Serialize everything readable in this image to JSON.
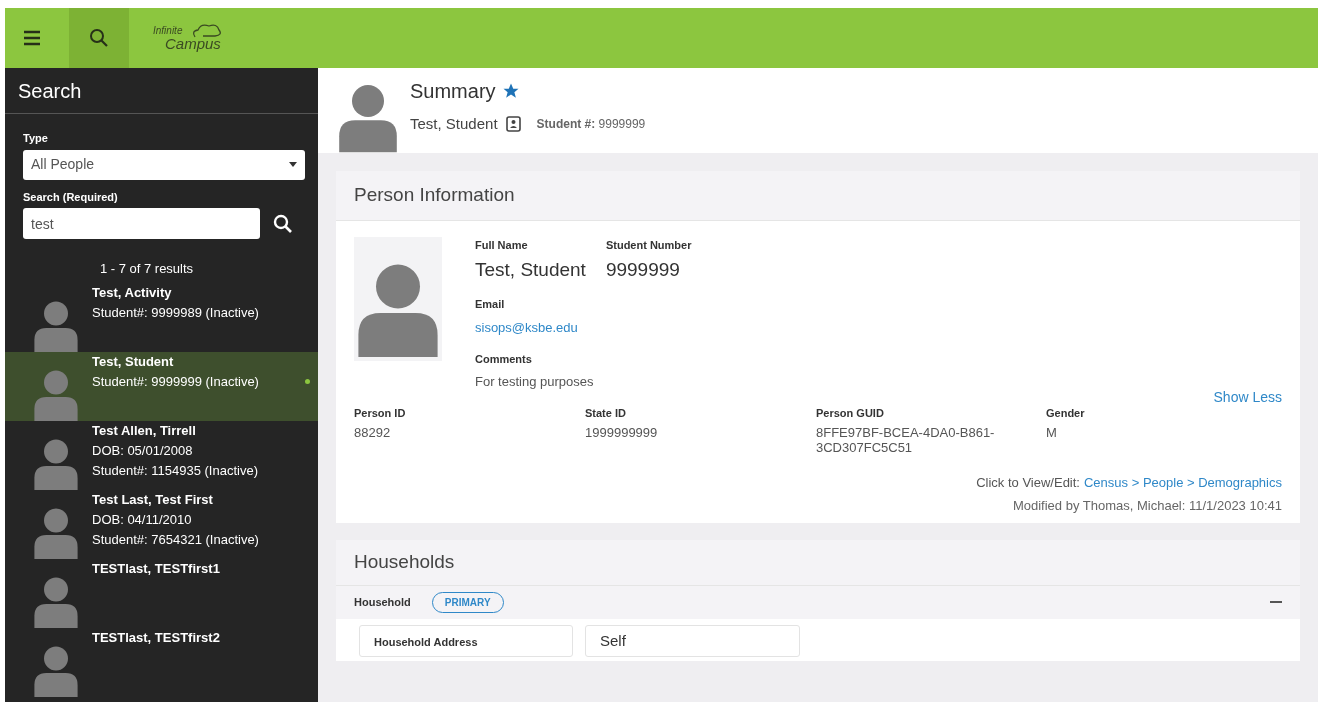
{
  "header": {
    "logo_line1": "Infinite",
    "logo_line2": "Campus"
  },
  "sidebar": {
    "title": "Search",
    "type_label": "Type",
    "type_value": "All People",
    "search_label": "Search (Required)",
    "search_value": "test",
    "results_count": "1 - 7 of 7 results",
    "results": [
      {
        "name": "Test, Activity",
        "lines": [
          "Student#: 9999989 (Inactive)"
        ],
        "selected": false,
        "dot": false
      },
      {
        "name": "Test, Student",
        "lines": [
          "Student#: 9999999 (Inactive)"
        ],
        "selected": true,
        "dot": true
      },
      {
        "name": "Test Allen, Tirrell",
        "lines": [
          "DOB: 05/01/2008",
          "Student#: 1154935 (Inactive)"
        ],
        "selected": false,
        "dot": false
      },
      {
        "name": "Test Last, Test First",
        "lines": [
          "DOB: 04/11/2010",
          "Student#: 7654321 (Inactive)"
        ],
        "selected": false,
        "dot": false
      },
      {
        "name": "TESTlast, TESTfirst1",
        "selected": false,
        "dot": false
      },
      {
        "name": "TESTlast, TESTfirst2",
        "selected": false,
        "dot": false
      }
    ]
  },
  "page_header": {
    "title": "Summary",
    "favorite": true,
    "name": "Test, Student",
    "student_number_label": "Student #:",
    "student_number": "9999999"
  },
  "person_information": {
    "title": "Person Information",
    "top_fields": [
      {
        "label": "Full Name",
        "value": "Test, Student"
      },
      {
        "label": "Student Number",
        "value": "9999999"
      }
    ],
    "email_label": "Email",
    "email": "sisops@ksbe.edu",
    "comments_label": "Comments",
    "comments": "For testing purposes",
    "show_less": "Show Less",
    "fields": [
      {
        "label": "Person ID",
        "value": "88292"
      },
      {
        "label": "State ID",
        "value": "1999999999"
      },
      {
        "label": "Person GUID",
        "value": "8FFE97BF-BCEA-4DA0-B861-3CD307FC5C51"
      },
      {
        "label": "Gender",
        "value": "M"
      }
    ],
    "view_edit_label": "Click to View/Edit:",
    "view_edit_link": "Census > People > Demographics",
    "modified": "Modified by Thomas, Michael: 11/1/2023 10:41"
  },
  "households": {
    "title": "Households",
    "household_label": "Household",
    "badge": "PRIMARY",
    "card_titles": [
      "Household Address",
      "Self"
    ]
  }
}
